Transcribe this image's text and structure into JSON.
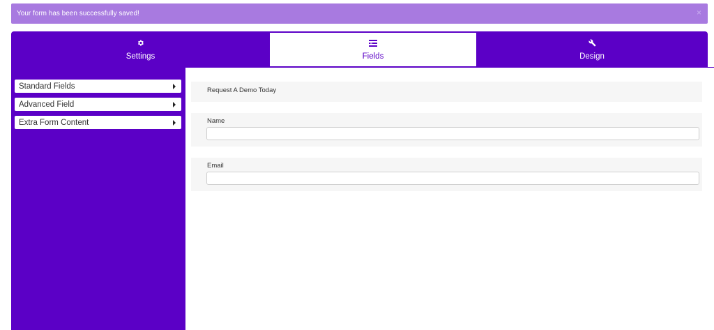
{
  "alert": {
    "message": "Your form has been successfully saved!",
    "close_symbol": "×"
  },
  "tabs": [
    {
      "label": "Settings",
      "icon": "gear-icon"
    },
    {
      "label": "Fields",
      "icon": "fields-list-icon",
      "active": true
    },
    {
      "label": "Design",
      "icon": "wrench-icon"
    }
  ],
  "sidebar": {
    "items": [
      {
        "label": "Standard Fields"
      },
      {
        "label": "Advanced Field"
      },
      {
        "label": "Extra Form Content"
      }
    ]
  },
  "form": {
    "title": "Request A Demo Today",
    "fields": [
      {
        "label": "Name",
        "value": "",
        "placeholder": ""
      },
      {
        "label": "Email",
        "value": "",
        "placeholder": ""
      }
    ]
  },
  "colors": {
    "primary": "#5b00c6",
    "alert_bg": "#a87ae0",
    "field_block_bg": "#f6f6f6"
  }
}
